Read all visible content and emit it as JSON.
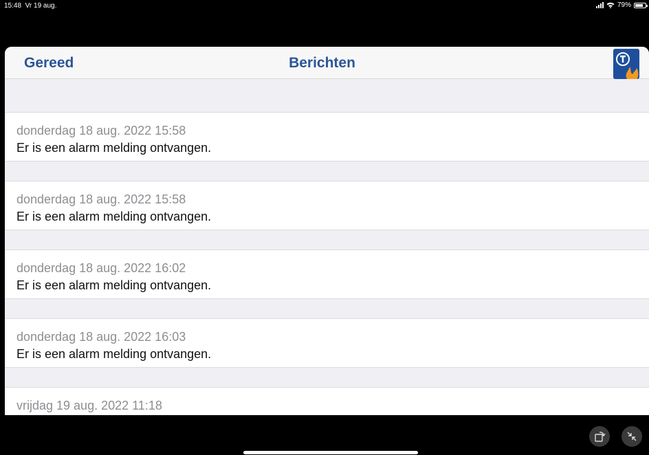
{
  "status": {
    "time": "15:48",
    "date": "Vr 19 aug.",
    "battery": "79%",
    "battery_level": 0.79
  },
  "navbar": {
    "done_label": "Gereed",
    "title": "Berichten"
  },
  "messages": [
    {
      "date": "donderdag 18 aug. 2022 15:58",
      "text": "Er is een alarm melding ontvangen."
    },
    {
      "date": "donderdag 18 aug. 2022 15:58",
      "text": "Er is een alarm melding ontvangen."
    },
    {
      "date": "donderdag 18 aug. 2022 16:02",
      "text": "Er is een alarm melding ontvangen."
    },
    {
      "date": "donderdag 18 aug. 2022 16:03",
      "text": "Er is een alarm melding ontvangen."
    },
    {
      "date": "vrijdag 19 aug. 2022 11:18",
      "text": ""
    }
  ],
  "icons": {
    "rotate": "rotate-icon",
    "collapse": "collapse-icon",
    "logo": "app-logo"
  },
  "colors": {
    "accent": "#2b5597",
    "logo_bg": "#1f4f9c",
    "flame": "#f29a1f"
  }
}
